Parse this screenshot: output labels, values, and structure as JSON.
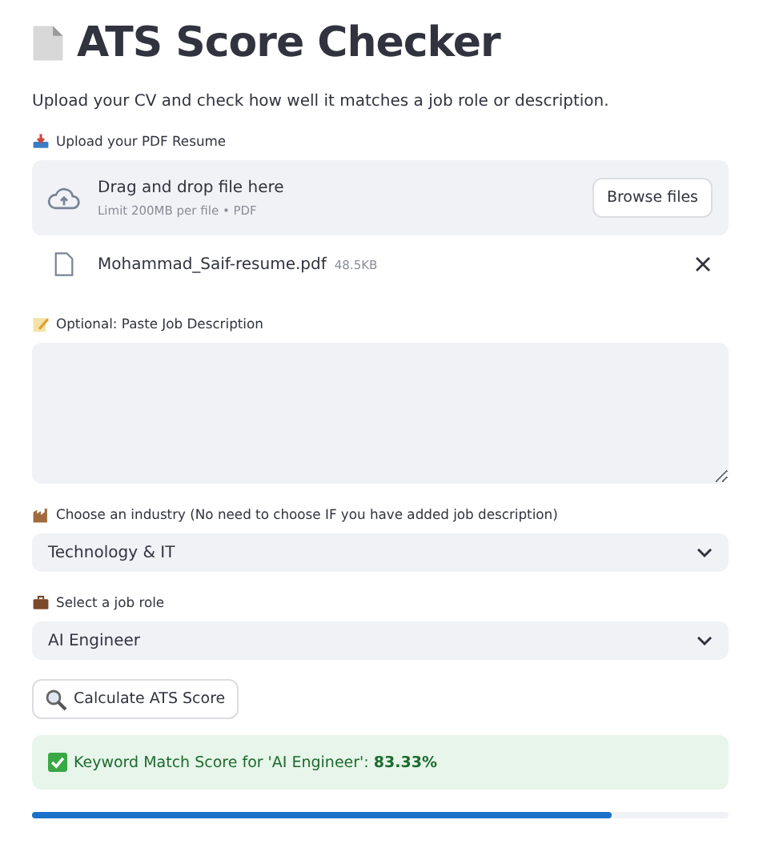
{
  "title": "ATS Score Checker",
  "subtitle": "Upload your CV and check how well it matches a job role or description.",
  "uploader": {
    "label": "Upload your PDF Resume",
    "prompt": "Drag and drop file here",
    "limit": "Limit 200MB per file • PDF",
    "button": "Browse files"
  },
  "file": {
    "name": "Mohammad_Saif-resume.pdf",
    "size": "48.5KB"
  },
  "job_description": {
    "label": "Optional: Paste Job Description"
  },
  "selects": [
    {
      "kind": "industry",
      "label": "Choose an industry (No need to choose IF you have added job description)",
      "value": "Technology & IT"
    },
    {
      "kind": "role",
      "label": "Select a job role",
      "value": "AI Engineer"
    }
  ],
  "button": "Calculate ATS Score",
  "result": {
    "text": "Keyword Match Score for 'AI Engineer': **83.33%**"
  },
  "progress": {
    "level": 0.8333
  }
}
